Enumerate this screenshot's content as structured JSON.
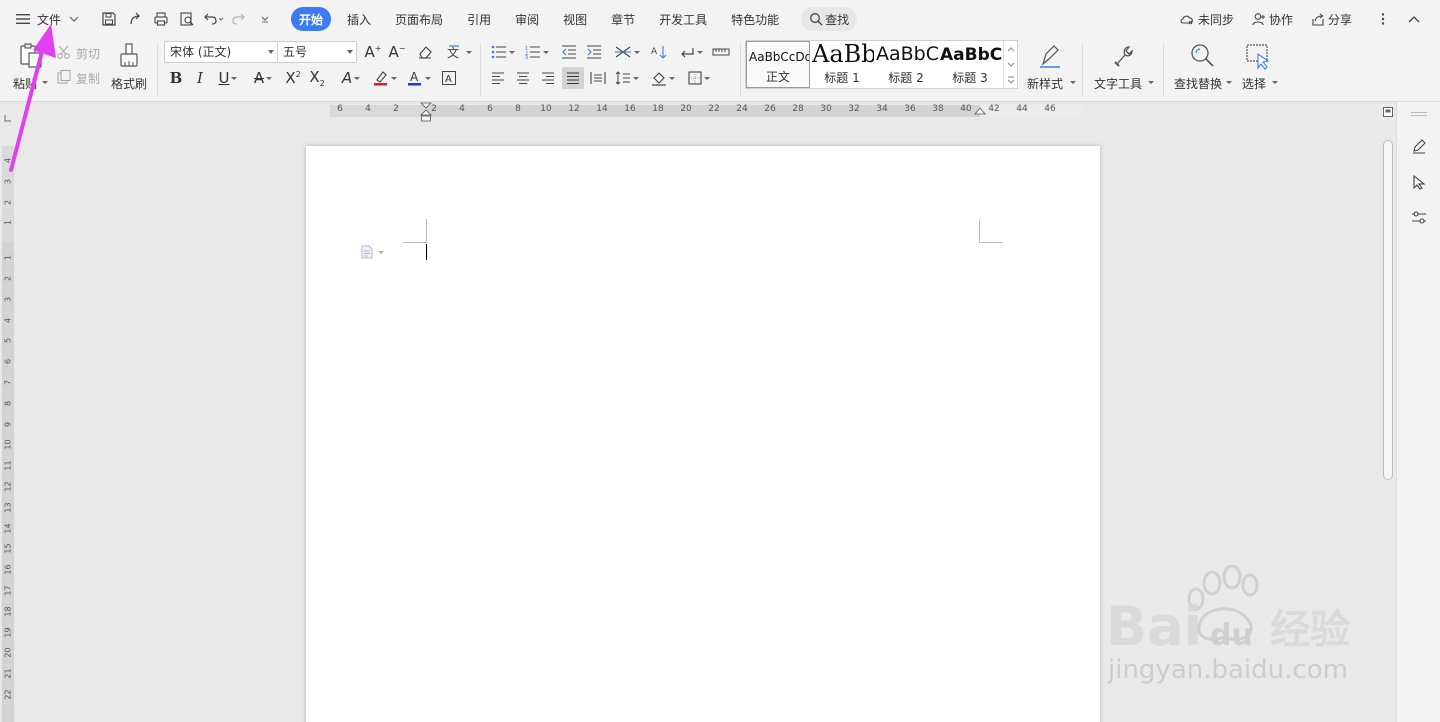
{
  "menubar": {
    "file_label": "文件",
    "tabs": [
      {
        "label": "开始",
        "active": true
      },
      {
        "label": "插入"
      },
      {
        "label": "页面布局"
      },
      {
        "label": "引用"
      },
      {
        "label": "审阅"
      },
      {
        "label": "视图"
      },
      {
        "label": "章节"
      },
      {
        "label": "开发工具"
      },
      {
        "label": "特色功能"
      }
    ],
    "search_label": "查找",
    "sync_label": "未同步",
    "collab_label": "协作",
    "share_label": "分享"
  },
  "ribbon": {
    "paste": "粘贴",
    "cut": "剪切",
    "copy": "复制",
    "format_painter": "格式刷",
    "font_name": "宋体 (正文)",
    "font_size": "五号",
    "styles": [
      {
        "preview": "AaBbCcDd",
        "caption": "正文"
      },
      {
        "preview": "AaBb",
        "caption": "标题 1"
      },
      {
        "preview": "AaBbC",
        "caption": "标题 2"
      },
      {
        "preview": "AaBbC",
        "caption": "标题 3"
      }
    ],
    "new_style": "新样式",
    "text_tools": "文字工具",
    "find_replace": "查找替换",
    "select": "选择"
  },
  "rulers": {
    "horizontal": [
      "6",
      "4",
      "2",
      "2",
      "4",
      "6",
      "8",
      "10",
      "12",
      "14",
      "16",
      "18",
      "20",
      "22",
      "24",
      "26",
      "28",
      "30",
      "32",
      "34",
      "36",
      "38",
      "40",
      "42",
      "44",
      "46"
    ],
    "vertical": [
      "4",
      "3",
      "2",
      "1",
      "1",
      "2",
      "3",
      "4",
      "5",
      "6",
      "7",
      "8",
      "9",
      "10",
      "11",
      "12",
      "13",
      "14",
      "15",
      "16",
      "17",
      "18",
      "19",
      "20",
      "21",
      "22"
    ]
  },
  "watermark": {
    "brand": "Baidu经验",
    "url": "jingyan.baidu.com"
  },
  "colors": {
    "accent": "#3c7bf4",
    "arrow": "#e040f0",
    "font_color_underline": "#1b3fc7",
    "highlight_underline": "#e02020"
  }
}
